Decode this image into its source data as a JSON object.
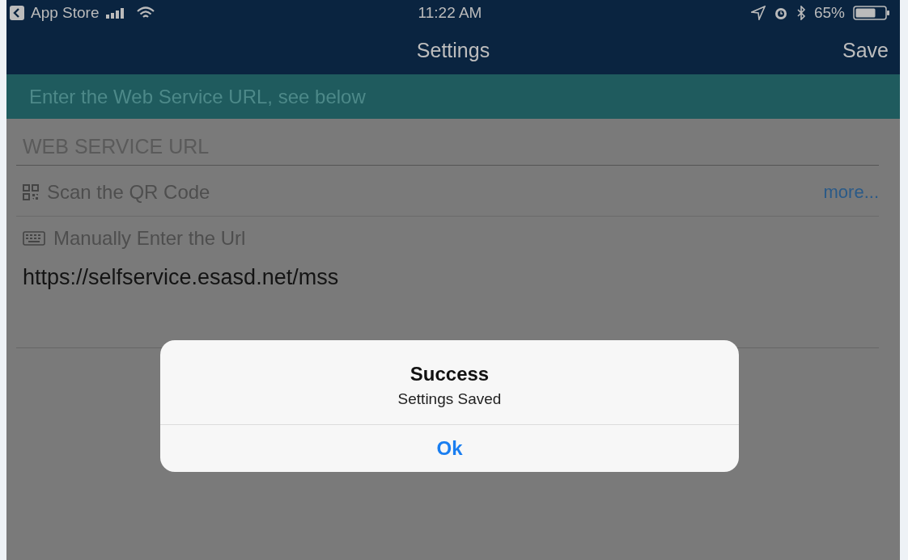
{
  "status_bar": {
    "back_label": "App Store",
    "time": "11:22 AM",
    "battery": "65%"
  },
  "nav_bar": {
    "title": "Settings",
    "action": "Save"
  },
  "banner": {
    "text": "Enter the Web Service URL, see below"
  },
  "section_header": "WEB SERVICE URL",
  "options": [
    {
      "kind": "qr",
      "label": "Scan the QR Code",
      "link": "more..."
    },
    {
      "kind": "keyboard",
      "label": "Manually Enter the Url",
      "value": "https://selfservice.esasd.net/mss"
    }
  ],
  "dialog": {
    "title": "Success",
    "message": "Settings Saved",
    "buttons": [
      "Ok"
    ]
  }
}
